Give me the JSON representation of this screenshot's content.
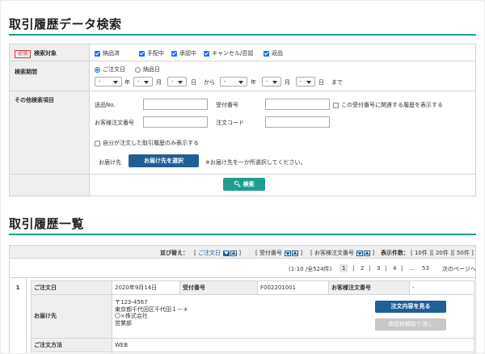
{
  "search_section": {
    "title": "取引履歴データ検索",
    "target": {
      "required_badge": "必須",
      "label": "検索対象",
      "options": [
        "納品済",
        "手配中",
        "承認中",
        "キャンセル/否認",
        "返品"
      ]
    },
    "period": {
      "label": "検索期間",
      "radio_options": [
        "ご注文日",
        "納品日"
      ],
      "select_value": "-",
      "unit_year": "年",
      "unit_month": "月",
      "unit_day": "日",
      "from": "から",
      "until": "まで"
    },
    "other": {
      "label": "その他検索項目",
      "shipping_no_label": "送品No.",
      "receipt_no_label": "受付番号",
      "related_history_checkbox": "この受付番号に関連する履歴を表示する",
      "customer_order_no_label": "お客様注文番号",
      "order_code_label": "注文コード",
      "self_only_checkbox": "自分が注文した取引履歴のみ表示する",
      "destination_label": "お届け先",
      "destination_button": "お届け先を選択",
      "destination_note": "※お届け先を一か所選択してください。"
    },
    "search_button": "検索"
  },
  "list_section": {
    "title": "取引履歴一覧",
    "sort": {
      "label": "並び替え：",
      "keys": [
        "ご注文日",
        "受付番号",
        "お客様注文番号"
      ],
      "count_label": "表示件数：",
      "count_options": [
        "[ 10件 ]",
        "[ 20件 ]",
        "[ 50件 ]"
      ]
    },
    "pagination": {
      "range": "(1-10 /全524件)",
      "pages": [
        "1",
        "2",
        "3",
        "4",
        "...",
        "53"
      ],
      "current": "1",
      "next": "次のページへ"
    },
    "record": {
      "index": "1",
      "order_date_label": "ご注文日",
      "order_date": "2020年9月14日",
      "receipt_no_label": "受付番号",
      "receipt_no": "F002201001",
      "customer_order_no_label": "お客様注文番号",
      "customer_order_no": "-",
      "destination_label": "お届け先",
      "destination_lines": [
        "〒123-4567",
        "東京都千代田区千代田１－＊",
        "〇×株式会社",
        "営業部"
      ],
      "view_button": "注文内容を見る",
      "cancel_button": "承認依頼取り消し",
      "method_label": "ご注文方法",
      "method": "WEB"
    }
  },
  "colors": {
    "accent_green": "#1f9e8f",
    "button_blue": "#1e5f96",
    "checkbox_blue": "#1a73e8",
    "required_red": "#d33333"
  }
}
